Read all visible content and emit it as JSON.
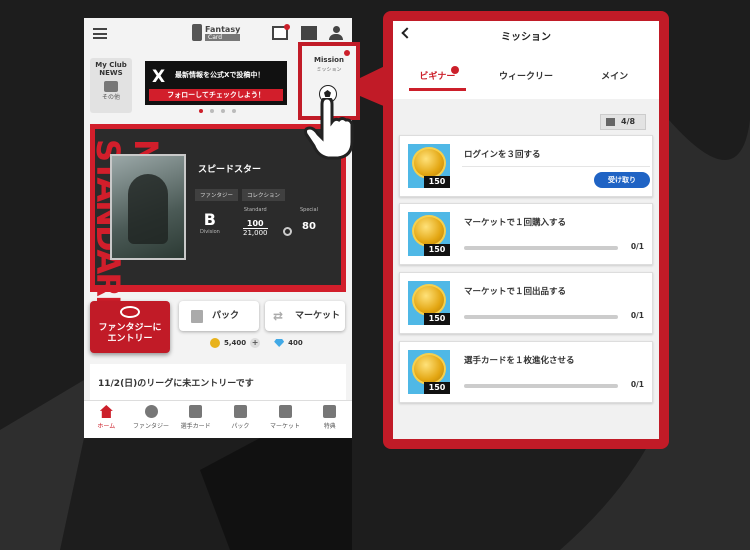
{
  "phone": {
    "logo": {
      "text": "Fantasy",
      "sub": "Card"
    },
    "club": {
      "line1": "My Club",
      "line2": "NEWS",
      "sub": "その他"
    },
    "x_banner": {
      "line1": "最新情報を公式Xで投稿中！",
      "line2": "フォローしてチェックしよう！"
    },
    "mission_shortcut": {
      "title": "Mission",
      "sub": "ミッション"
    },
    "card": {
      "name": "スピードスター",
      "tags": [
        "ファンタジー",
        "コレクション"
      ],
      "division_grade": "B",
      "division_label": "Division",
      "standard_label": "Standard",
      "standard_value": "100",
      "standard_max": "21,000",
      "special_label": "Special",
      "special_value": "80",
      "vertical_text": "NEO STANDARD"
    },
    "entry_button": "ファンタジーにエントリー",
    "pack_button": "パック",
    "market_button": "マーケット",
    "coins": "5,400",
    "gems": "400",
    "notice": "11/2(日)のリーグに未エントリーです",
    "nav": [
      {
        "label": "ホーム",
        "active": true
      },
      {
        "label": "ファンタジー"
      },
      {
        "label": "選手カード"
      },
      {
        "label": "パック"
      },
      {
        "label": "マーケット"
      },
      {
        "label": "特典"
      }
    ]
  },
  "panel": {
    "title": "ミッション",
    "tabs": [
      {
        "label": "ビギナー",
        "active": true
      },
      {
        "label": "ウィークリー"
      },
      {
        "label": "メイン"
      }
    ],
    "progress": "4/8",
    "missions": [
      {
        "title": "ログインを３回する",
        "reward": "150",
        "claim_label": "受け取り"
      },
      {
        "title": "マーケットで１回購入する",
        "reward": "150",
        "count": "0/1",
        "progress": 0
      },
      {
        "title": "マーケットで１回出品する",
        "reward": "150",
        "count": "0/1",
        "progress": 0
      },
      {
        "title": "選手カードを１枚進化させる",
        "reward": "150",
        "count": "0/1",
        "progress": 0
      }
    ]
  },
  "colors": {
    "accent": "#c11b27",
    "claim": "#1f63c4",
    "reward_bg": "#4fb8e6"
  }
}
